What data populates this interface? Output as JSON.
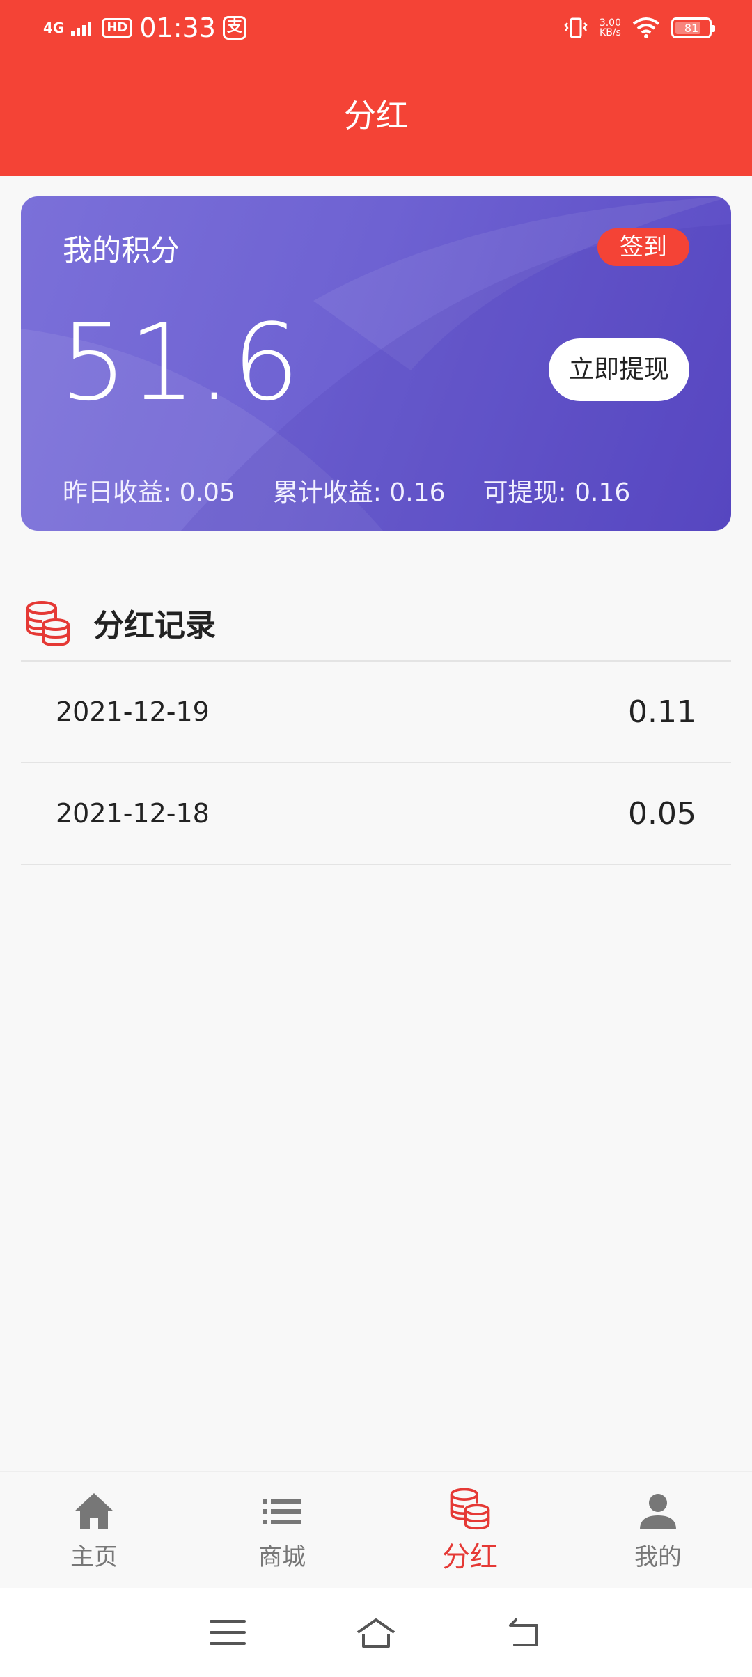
{
  "status_bar": {
    "signal": "4G",
    "hd": "HD",
    "time": "01:33",
    "alipay_glyph": "支",
    "speed_value": "3.00",
    "speed_unit": "KB/s",
    "battery": "81",
    "battery_level_percent": 81
  },
  "header": {
    "title": "分红"
  },
  "card": {
    "label": "我的积分",
    "checkin_label": "签到",
    "points": "51.6",
    "withdraw_label": "立即提现",
    "stats": [
      {
        "label": "昨日收益:",
        "value": "0.05"
      },
      {
        "label": "累计收益:",
        "value": "0.16"
      },
      {
        "label": "可提现:",
        "value": "0.16"
      }
    ]
  },
  "records": {
    "icon": "coins-stack-icon",
    "title": "分红记录",
    "rows": [
      {
        "date": "2021-12-19",
        "amount": "0.11"
      },
      {
        "date": "2021-12-18",
        "amount": "0.05"
      }
    ]
  },
  "tabbar": {
    "items": [
      {
        "label": "主页",
        "icon": "home-icon"
      },
      {
        "label": "商城",
        "icon": "list-icon"
      },
      {
        "label": "分红",
        "icon": "coins-stack-icon",
        "active": true
      },
      {
        "label": "我的",
        "icon": "user-icon"
      }
    ]
  },
  "colors": {
    "header": "#f44336",
    "card_gradient_start": "#7b70d9",
    "card_gradient_end": "#5a4ac4",
    "accent": "#e53935",
    "inactive_tab": "#777777"
  },
  "system_nav": {
    "icons": [
      "menu-icon",
      "home-outline-icon",
      "back-icon"
    ]
  }
}
